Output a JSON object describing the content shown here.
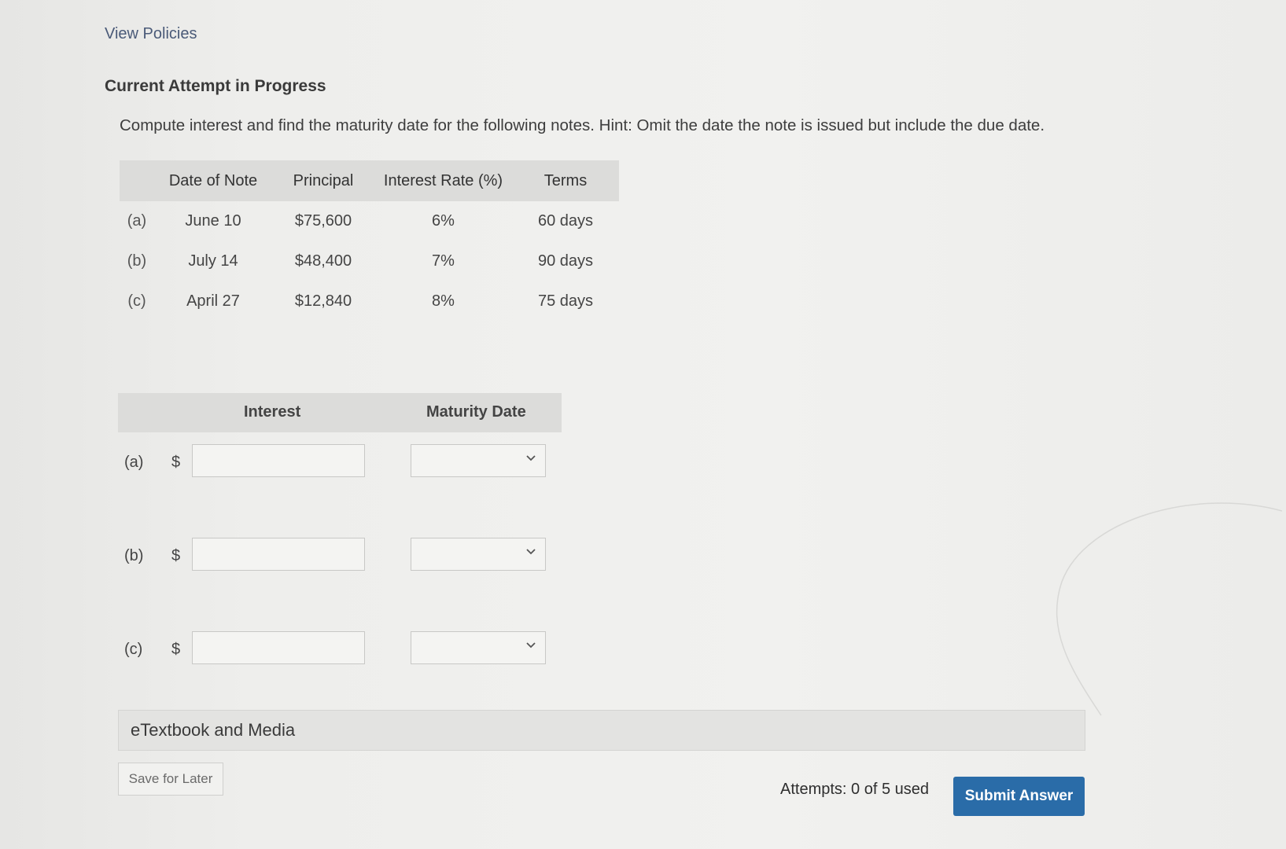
{
  "links": {
    "view_policies": "View Policies"
  },
  "heading": "Current Attempt in Progress",
  "instructions": "Compute interest and find the maturity date for the following notes. Hint: Omit the date the note is issued but include the due date.",
  "notes_table": {
    "headers": [
      "",
      "Date of Note",
      "Principal",
      "Interest Rate (%)",
      "Terms"
    ],
    "rows": [
      {
        "label": "(a)",
        "date": "June 10",
        "principal": "$75,600",
        "rate": "6%",
        "terms": "60 days"
      },
      {
        "label": "(b)",
        "date": "July 14",
        "principal": "$48,400",
        "rate": "7%",
        "terms": "90 days"
      },
      {
        "label": "(c)",
        "date": "April 27",
        "principal": "$12,840",
        "rate": "8%",
        "terms": "75 days"
      }
    ]
  },
  "answer_table": {
    "interest_header": "Interest",
    "maturity_header": "Maturity Date",
    "currency_symbol": "$",
    "rows": [
      {
        "label": "(a)",
        "interest_value": "",
        "maturity_value": ""
      },
      {
        "label": "(b)",
        "interest_value": "",
        "maturity_value": ""
      },
      {
        "label": "(c)",
        "interest_value": "",
        "maturity_value": ""
      }
    ]
  },
  "etextbook": {
    "label": "eTextbook and Media"
  },
  "footer": {
    "save_label": "Save for Later",
    "attempts_text": "Attempts: 0 of 5 used",
    "submit_label": "Submit Answer"
  },
  "colors": {
    "accent": "#2a6ca8",
    "link": "#4a5a78",
    "header_bg": "#dcdcda"
  },
  "icons": {
    "dropdown": "chevron-down-icon"
  }
}
